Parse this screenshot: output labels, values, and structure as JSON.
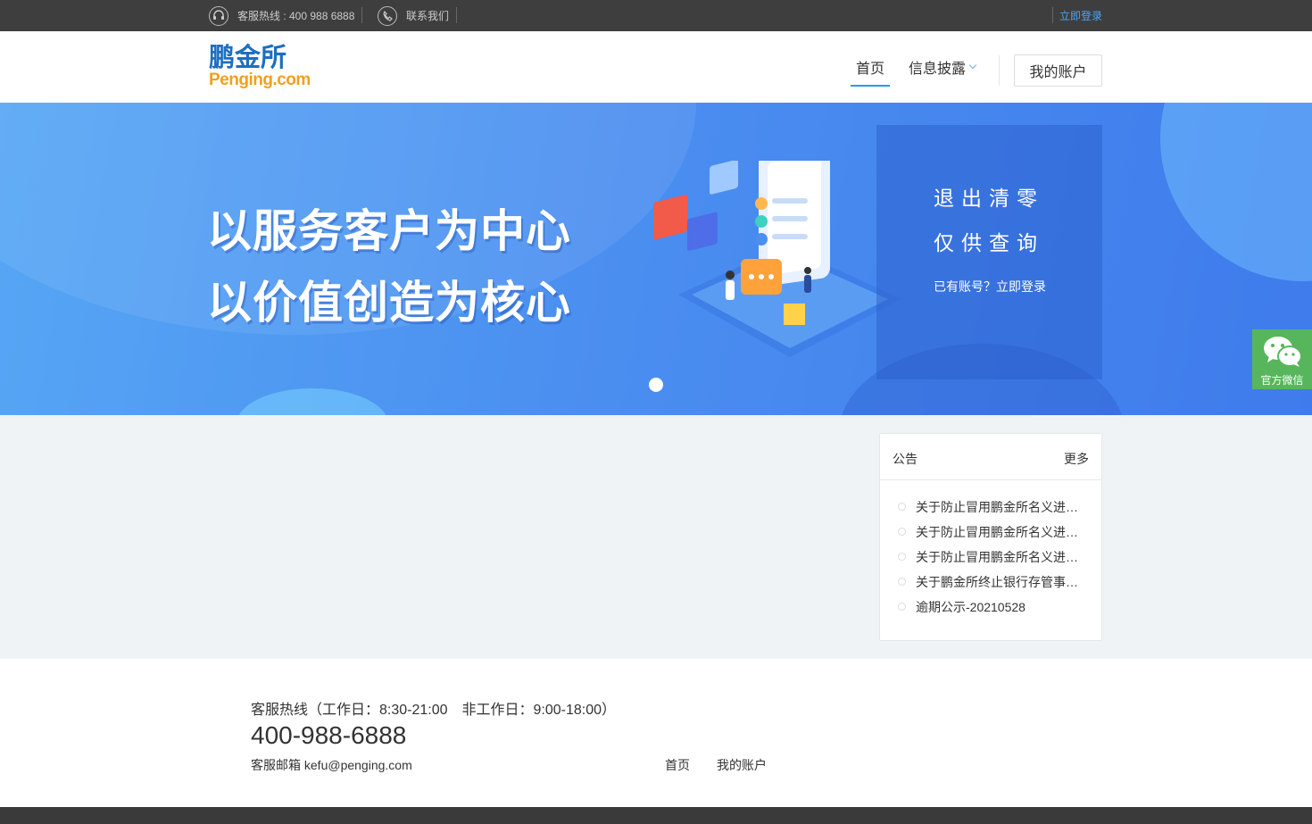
{
  "topbar": {
    "hotline": "客服热线 : 400 988 6888",
    "contact": "联系我们",
    "login": "立即登录"
  },
  "header": {
    "logo_cn": "鹏金所",
    "logo_en": "Penging.com",
    "nav": [
      {
        "label": "首页",
        "active": true
      },
      {
        "label": "信息披露",
        "dropdown": true
      }
    ],
    "account_button": "我的账户"
  },
  "banner": {
    "slogan_line1": "以服务客户为中心",
    "slogan_line2": "以价值创造为核心",
    "slide_count": 1,
    "active_slide": 1,
    "panel": {
      "line1": "退出清零",
      "line2": "仅供查询",
      "login_link": "已有账号？立即登录"
    }
  },
  "wechat": {
    "label": "官方微信",
    "color": "#57b65b"
  },
  "notice": {
    "title": "公告",
    "more": "更多",
    "items": [
      "关于防止冒用鹏金所名义进…",
      "关于防止冒用鹏金所名义进…",
      "关于防止冒用鹏金所名义进…",
      "关于鹏金所终止银行存管事…",
      "逾期公示-20210528"
    ]
  },
  "footer": {
    "hotline_hours": "客服热线（工作日：8:30-21:00　非工作日：9:00-18:00）",
    "phone": "400-988-6888",
    "email": "客服邮箱 kefu@penging.com",
    "links": [
      "首页",
      "我的账户"
    ]
  },
  "colors": {
    "topbar_bg": "#3e3e3e",
    "accent": "#1fa0e0",
    "banner_blue": "#4b8ff0",
    "logo_blue": "#1d6fc0",
    "logo_orange": "#f0a020"
  }
}
